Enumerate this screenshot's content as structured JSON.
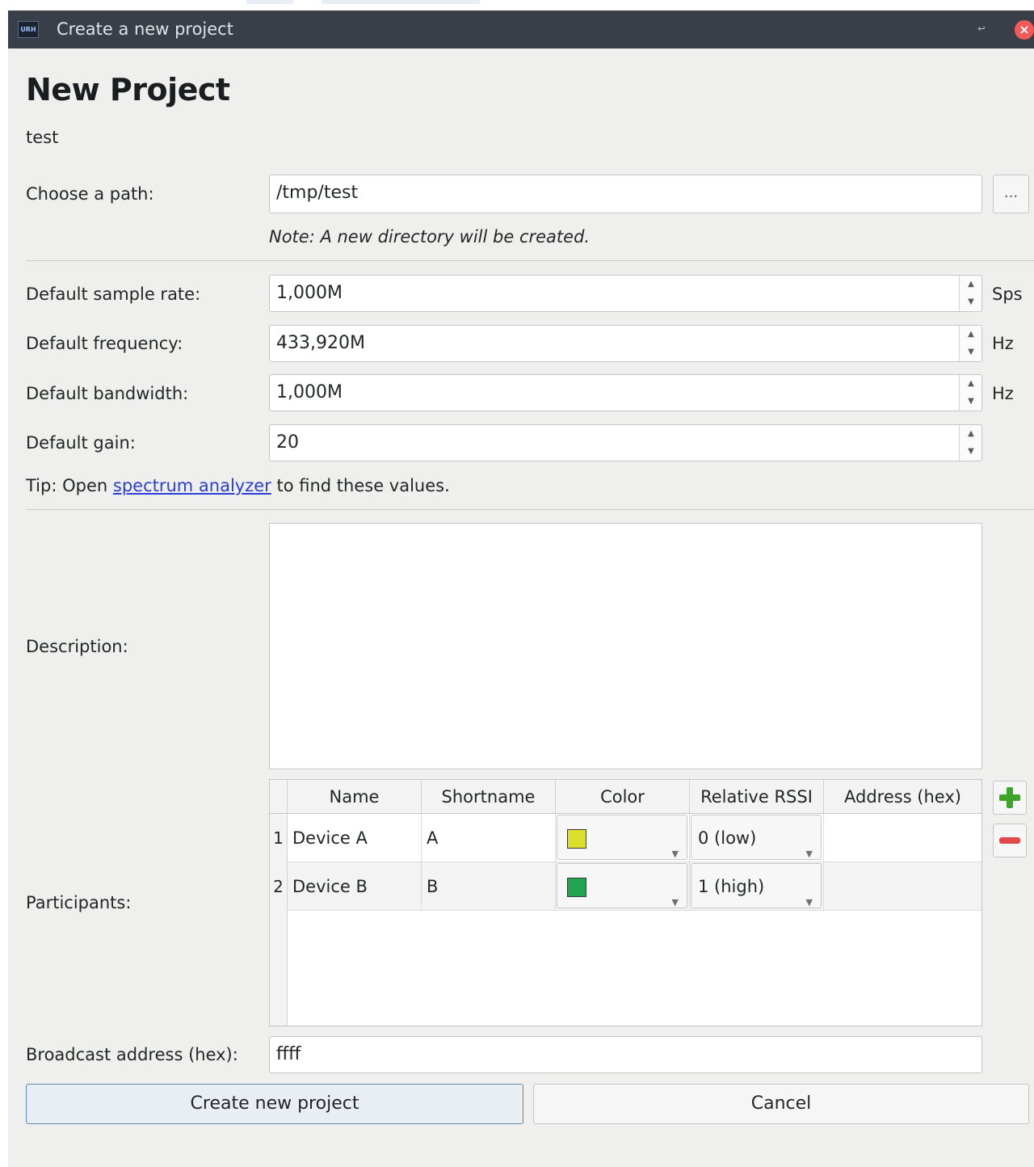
{
  "window": {
    "title": "Create a new project"
  },
  "heading": "New Project",
  "project_name": "test",
  "path": {
    "label": "Choose a path:",
    "value": "/tmp/test",
    "browse_label": "...",
    "note": "Note: A new directory will be created."
  },
  "sample_rate": {
    "label": "Default sample rate:",
    "value": "1,000M",
    "unit": "Sps"
  },
  "frequency": {
    "label": "Default frequency:",
    "value": "433,920M",
    "unit": "Hz"
  },
  "bandwidth": {
    "label": "Default bandwidth:",
    "value": "1,000M",
    "unit": "Hz"
  },
  "gain": {
    "label": "Default gain:",
    "value": "20"
  },
  "tip": {
    "prefix": "Tip: Open ",
    "link": "spectrum analyzer",
    "suffix": " to find these values."
  },
  "description": {
    "label": "Description:",
    "value": ""
  },
  "participants": {
    "label": "Participants:",
    "columns": [
      "Name",
      "Shortname",
      "Color",
      "Relative RSSI",
      "Address (hex)"
    ],
    "rows": [
      {
        "index": "1",
        "name": "Device A",
        "shortname": "A",
        "color": "#d9df2a",
        "rssi": "0 (low)",
        "address": ""
      },
      {
        "index": "2",
        "name": "Device B",
        "shortname": "B",
        "color": "#22a552",
        "rssi": "1 (high)",
        "address": ""
      }
    ],
    "add_icon": "plus-icon",
    "remove_icon": "minus-icon"
  },
  "broadcast": {
    "label": "Broadcast address (hex):",
    "value": "ffff"
  },
  "buttons": {
    "create": "Create new project",
    "cancel": "Cancel"
  }
}
